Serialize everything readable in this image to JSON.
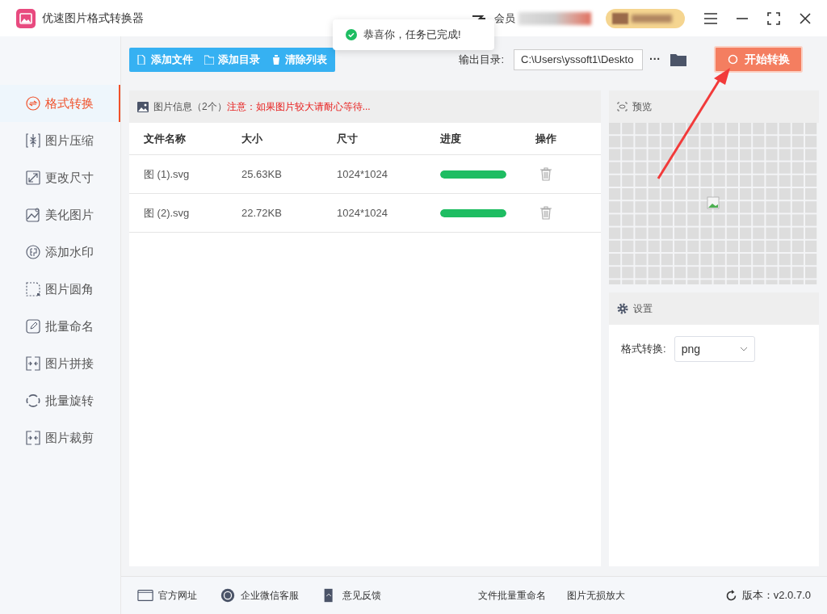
{
  "window": {
    "title": "优速图片格式转换器",
    "member_label": "会员"
  },
  "toast": {
    "text": "恭喜你，任务已完成!"
  },
  "toolbar": {
    "buttons": [
      {
        "label": "添加文件"
      },
      {
        "label": "添加目录"
      },
      {
        "label": "清除列表"
      }
    ],
    "output_label": "输出目录:",
    "output_path": "C:\\Users\\yssoft1\\Deskto",
    "more": "···",
    "start_button": "开始转换"
  },
  "sidebar": {
    "items": [
      {
        "label": "格式转换",
        "selected": true
      },
      {
        "label": "图片压缩",
        "selected": false
      },
      {
        "label": "更改尺寸",
        "selected": false
      },
      {
        "label": "美化图片",
        "selected": false
      },
      {
        "label": "添加水印",
        "selected": false
      },
      {
        "label": "图片圆角",
        "selected": false
      },
      {
        "label": "批量命名",
        "selected": false
      },
      {
        "label": "图片拼接",
        "selected": false
      },
      {
        "label": "批量旋转",
        "selected": false
      },
      {
        "label": "图片裁剪",
        "selected": false
      }
    ]
  },
  "file_panel": {
    "title": "图片信息（2个）",
    "notice": "注意：如果图片较大请耐心等待...",
    "columns": [
      "文件名称",
      "大小",
      "尺寸",
      "进度",
      "操作"
    ],
    "rows": [
      {
        "name": "图 (1).svg",
        "size": "25.63KB",
        "dimensions": "1024*1024",
        "level": 1
      },
      {
        "name": "图 (2).svg",
        "size": "22.72KB",
        "dimensions": "1024*1024",
        "level": 1
      }
    ]
  },
  "preview": {
    "title": "预览"
  },
  "settings": {
    "title": "设置",
    "format_label": "格式转换:",
    "format_value": "png"
  },
  "footer": {
    "links": [
      "官方网址",
      "企业微信客服",
      "意见反馈"
    ],
    "tools": [
      "文件批量重命名",
      "图片无损放大"
    ],
    "version": "版本：v2.0.7.0"
  }
}
